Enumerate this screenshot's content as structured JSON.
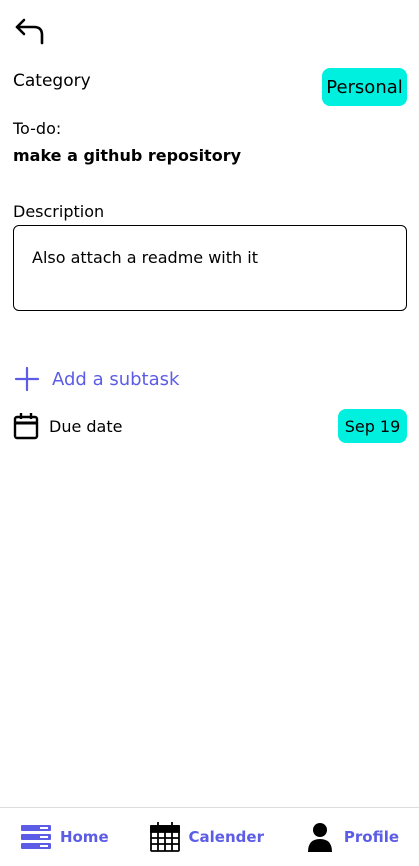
{
  "header": {
    "back_icon": "back-arrow-icon"
  },
  "category": {
    "label": "Category",
    "value": "Personal",
    "badge_color": "#00f0e0"
  },
  "todo": {
    "label": "To-do:",
    "title": "make a github repository"
  },
  "description": {
    "label": "Description",
    "text": "Also attach a readme with it"
  },
  "subtask": {
    "label": "Add a subtask",
    "icon": "plus-icon",
    "color": "#5c5ce6"
  },
  "due": {
    "label": "Due date",
    "value": "Sep 19",
    "icon": "calendar-icon"
  },
  "nav": {
    "items": [
      {
        "label": "Home",
        "icon": "home-list-icon"
      },
      {
        "label": "Calender",
        "icon": "calendar-grid-icon"
      },
      {
        "label": "Profile",
        "icon": "person-icon"
      }
    ]
  }
}
